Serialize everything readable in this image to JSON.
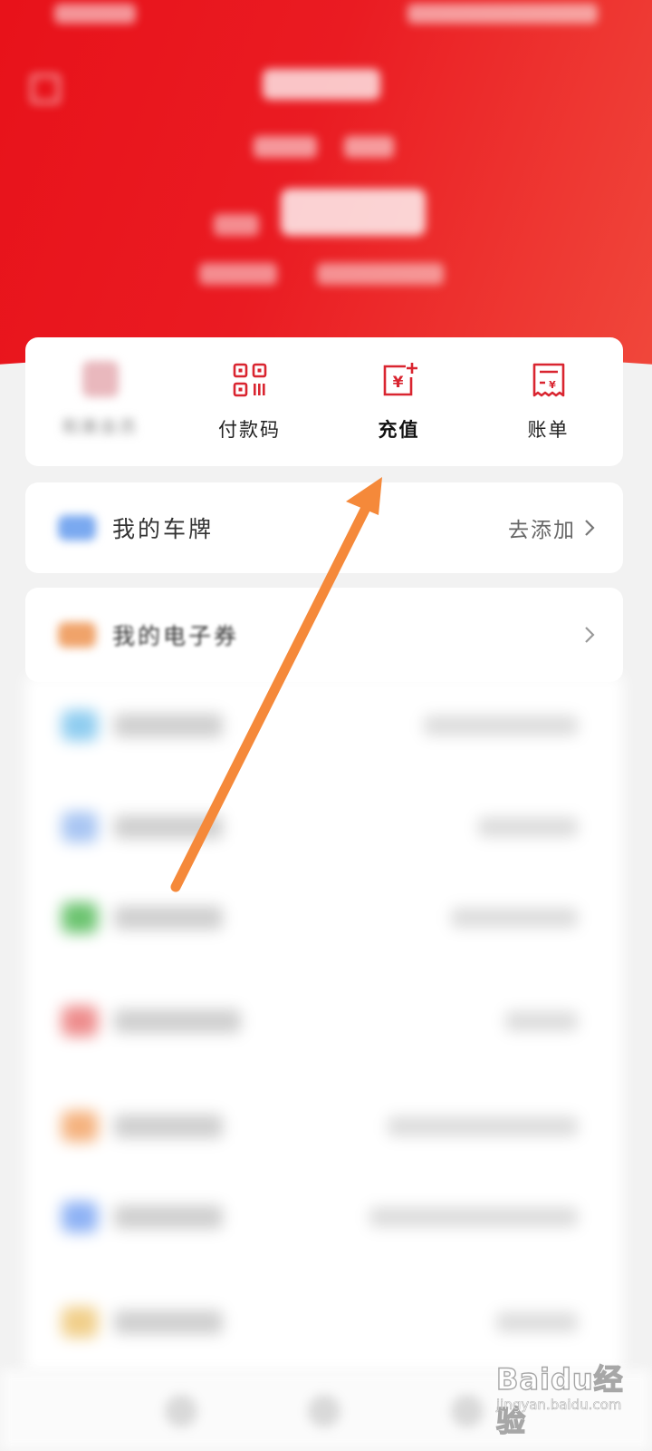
{
  "quick_actions": [
    {
      "label": "和美会员",
      "icon": "member-icon"
    },
    {
      "label": "付款码",
      "icon": "qr-code-icon"
    },
    {
      "label": "充值",
      "icon": "recharge-icon"
    },
    {
      "label": "账单",
      "icon": "bill-icon"
    }
  ],
  "rows": {
    "plate": {
      "title": "我的车牌",
      "action": "去添加",
      "icon_color": "#7aa9f0"
    },
    "coupon": {
      "title": "我的电子券",
      "icon_color": "#f0a36a"
    }
  },
  "colors": {
    "brand_red": "#e8121a",
    "icon_red": "#d92530",
    "arrow": "#f5893a",
    "blurred_icon_colors": [
      "#8fcdf0",
      "#a9c6f3",
      "#6cc470",
      "#ee8d8d",
      "#f5b27e",
      "#8eb2f5",
      "#f1cf8a"
    ]
  },
  "watermark": {
    "brand": "Baidu经验",
    "url": "jingyan.baidu.com"
  }
}
